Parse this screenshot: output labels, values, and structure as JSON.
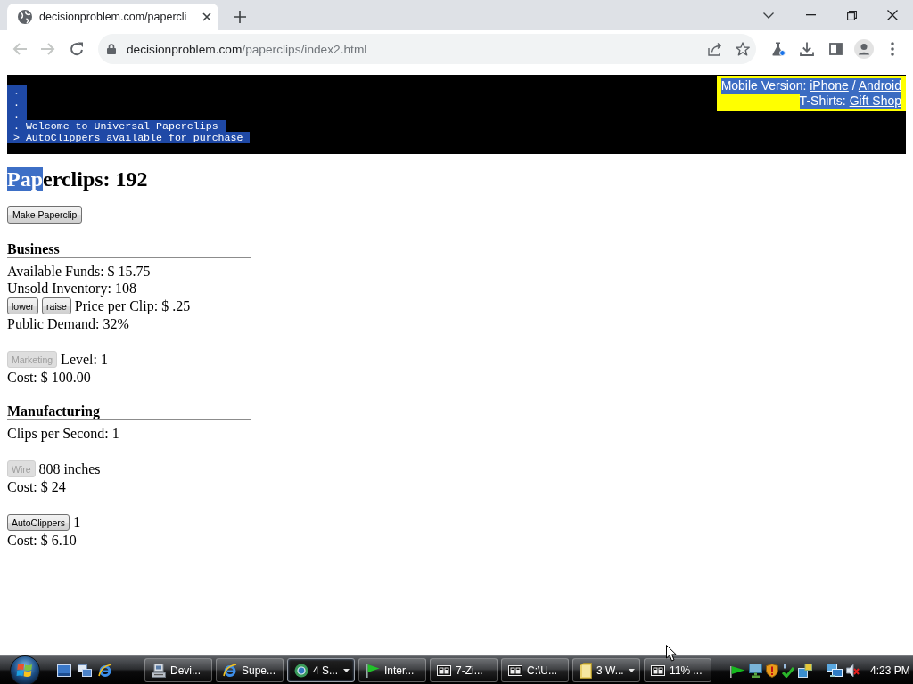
{
  "browser": {
    "tabs": [
      {
        "title": "decisionproblem.com/papercli",
        "selected": true
      }
    ],
    "back": {
      "disabled": true
    },
    "forward": {
      "disabled": true
    },
    "address": {
      "host": "decisionproblem.com",
      "path": "/paperclips/index2.html"
    }
  },
  "console": {
    "lines": [
      {
        "text": ".",
        "selected": true
      },
      {
        "text": ".",
        "selected": true
      },
      {
        "text": ".",
        "selected": true
      },
      {
        "text": ". Welcome to Universal Paperclips",
        "selected": true
      },
      {
        "text": "> AutoClippers available for purchase",
        "selected": true
      }
    ]
  },
  "promo": {
    "selected": true,
    "lines": [
      [
        {
          "kind": "text",
          "text": "Mobile Version: "
        },
        {
          "kind": "link",
          "text": "iPhone"
        },
        {
          "kind": "text",
          "text": " / "
        },
        {
          "kind": "link",
          "text": "Android"
        }
      ],
      [
        {
          "kind": "text",
          "text": "T-Shirts: "
        },
        {
          "kind": "link",
          "text": "Gift Shop"
        }
      ]
    ]
  },
  "title": [
    {
      "text": "Pap",
      "selected": true
    },
    {
      "text": "erclips: 192",
      "selected": false
    }
  ],
  "make_button": {
    "label": "Make Paperclip",
    "disabled": false
  },
  "sections": [
    {
      "title": "Business",
      "groups": [
        [
          [
            {
              "kind": "text",
              "text": "Available Funds: $ 15.75"
            }
          ],
          [
            {
              "kind": "text",
              "text": "Unsold Inventory: 108"
            }
          ],
          [
            {
              "kind": "button",
              "text": "lower",
              "disabled": false
            },
            {
              "kind": "button",
              "text": "raise",
              "disabled": false
            },
            {
              "kind": "text",
              "text": "Price per Clip: $ .25"
            }
          ],
          [
            {
              "kind": "text",
              "text": "Public Demand: 32%"
            }
          ]
        ],
        [
          [
            {
              "kind": "button",
              "text": "Marketing",
              "disabled": true
            },
            {
              "kind": "text",
              "text": "Level: 1"
            }
          ],
          [
            {
              "kind": "text",
              "text": "Cost: $ 100.00"
            }
          ]
        ]
      ]
    },
    {
      "title": "Manufacturing",
      "groups": [
        [
          [
            {
              "kind": "text",
              "text": "Clips per Second: 1"
            }
          ]
        ],
        [
          [
            {
              "kind": "button",
              "text": "Wire",
              "disabled": true
            },
            {
              "kind": "text",
              "text": "808 inches"
            }
          ],
          [
            {
              "kind": "text",
              "text": "Cost: $ 24"
            }
          ]
        ],
        [
          [
            {
              "kind": "button",
              "text": "AutoClippers",
              "disabled": false
            },
            {
              "kind": "text",
              "text": "1"
            }
          ],
          [
            {
              "kind": "text",
              "text": "Cost: $ 6.10"
            }
          ]
        ]
      ]
    }
  ],
  "taskbar": {
    "tasks": [
      {
        "kind": "computer",
        "label": "Devi...",
        "selected": false,
        "grouped": false
      },
      {
        "kind": "orbit",
        "label": "Supe...",
        "selected": false,
        "grouped": false
      },
      {
        "kind": "globe",
        "label": "4 S...",
        "selected": true,
        "grouped": true
      },
      {
        "kind": "flag",
        "label": "Inter...",
        "selected": false,
        "grouped": false
      },
      {
        "kind": "archive",
        "label": "7-Zi...",
        "selected": false,
        "grouped": false
      },
      {
        "kind": "archive",
        "label": "C:\\U...",
        "selected": false,
        "grouped": false
      },
      {
        "kind": "folder",
        "label": "3 W...",
        "selected": false,
        "grouped": true
      },
      {
        "kind": "archive",
        "label": "11% ...",
        "selected": false,
        "grouped": false
      }
    ],
    "clock": "4:23 PM"
  }
}
